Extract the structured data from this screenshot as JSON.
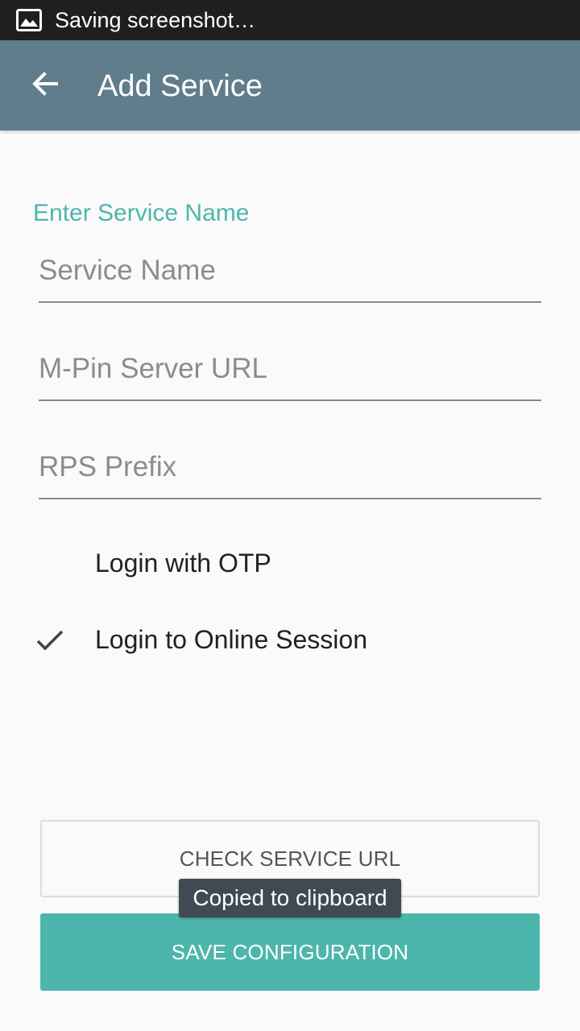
{
  "status_bar": {
    "notification_icon": "image-icon",
    "text": "Saving screenshot…"
  },
  "app_bar": {
    "back_icon": "arrow-left-icon",
    "title": "Add Service"
  },
  "form": {
    "section_label": "Enter Service Name",
    "service_name": {
      "value": "",
      "placeholder": "Service Name"
    },
    "server_url": {
      "value": "",
      "placeholder": "M-Pin Server URL"
    },
    "rps_prefix": {
      "value": "",
      "placeholder": "RPS Prefix"
    }
  },
  "options": [
    {
      "label": "Login with OTP",
      "checked": false
    },
    {
      "label": "Login to Online Session",
      "checked": true
    }
  ],
  "buttons": {
    "check_label": "CHECK SERVICE URL",
    "save_label": "SAVE CONFIGURATION"
  },
  "toast": {
    "text": "Copied to clipboard"
  },
  "colors": {
    "status_bar": "#1f1f1f",
    "app_bar": "#607d8b",
    "accent": "#4db6ac",
    "background": "#fafafa",
    "toast": "#3f4a52"
  }
}
